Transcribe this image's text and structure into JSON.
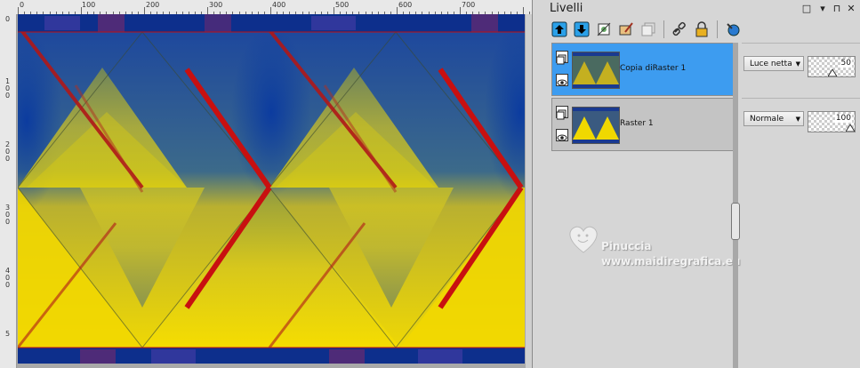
{
  "ruler": {
    "top_labels": [
      "0",
      "100",
      "200",
      "300",
      "400",
      "500",
      "600",
      "700"
    ],
    "left_labels": [
      "0",
      "1\n0\n0",
      "2\n0\n0",
      "3\n0\n0",
      "4\n0\n0",
      "5"
    ]
  },
  "panel": {
    "title": "Livelli",
    "controls": [
      "□",
      "▾",
      "⊓",
      "✕"
    ]
  },
  "toolbar": {
    "icons": [
      "layer-up-icon",
      "layer-down-icon",
      "new-layer-icon",
      "brush-layer-icon",
      "duplicate-layer-icon",
      "link-icon",
      "lock-icon",
      "info-icon"
    ]
  },
  "layers": [
    {
      "name": "Copia diRaster 1",
      "blend": "Luce netta",
      "opacity": "50",
      "selected": true
    },
    {
      "name": "Raster 1",
      "blend": "Normale",
      "opacity": "100",
      "selected": false
    }
  ],
  "watermark": {
    "line1": "Pinuccia",
    "line2": "www.maidiregrafica.eu"
  },
  "colors": {
    "accent": "#3d9cf0",
    "blue": "#0a3aa0",
    "yellow": "#f6dc00",
    "red": "#c01010"
  }
}
